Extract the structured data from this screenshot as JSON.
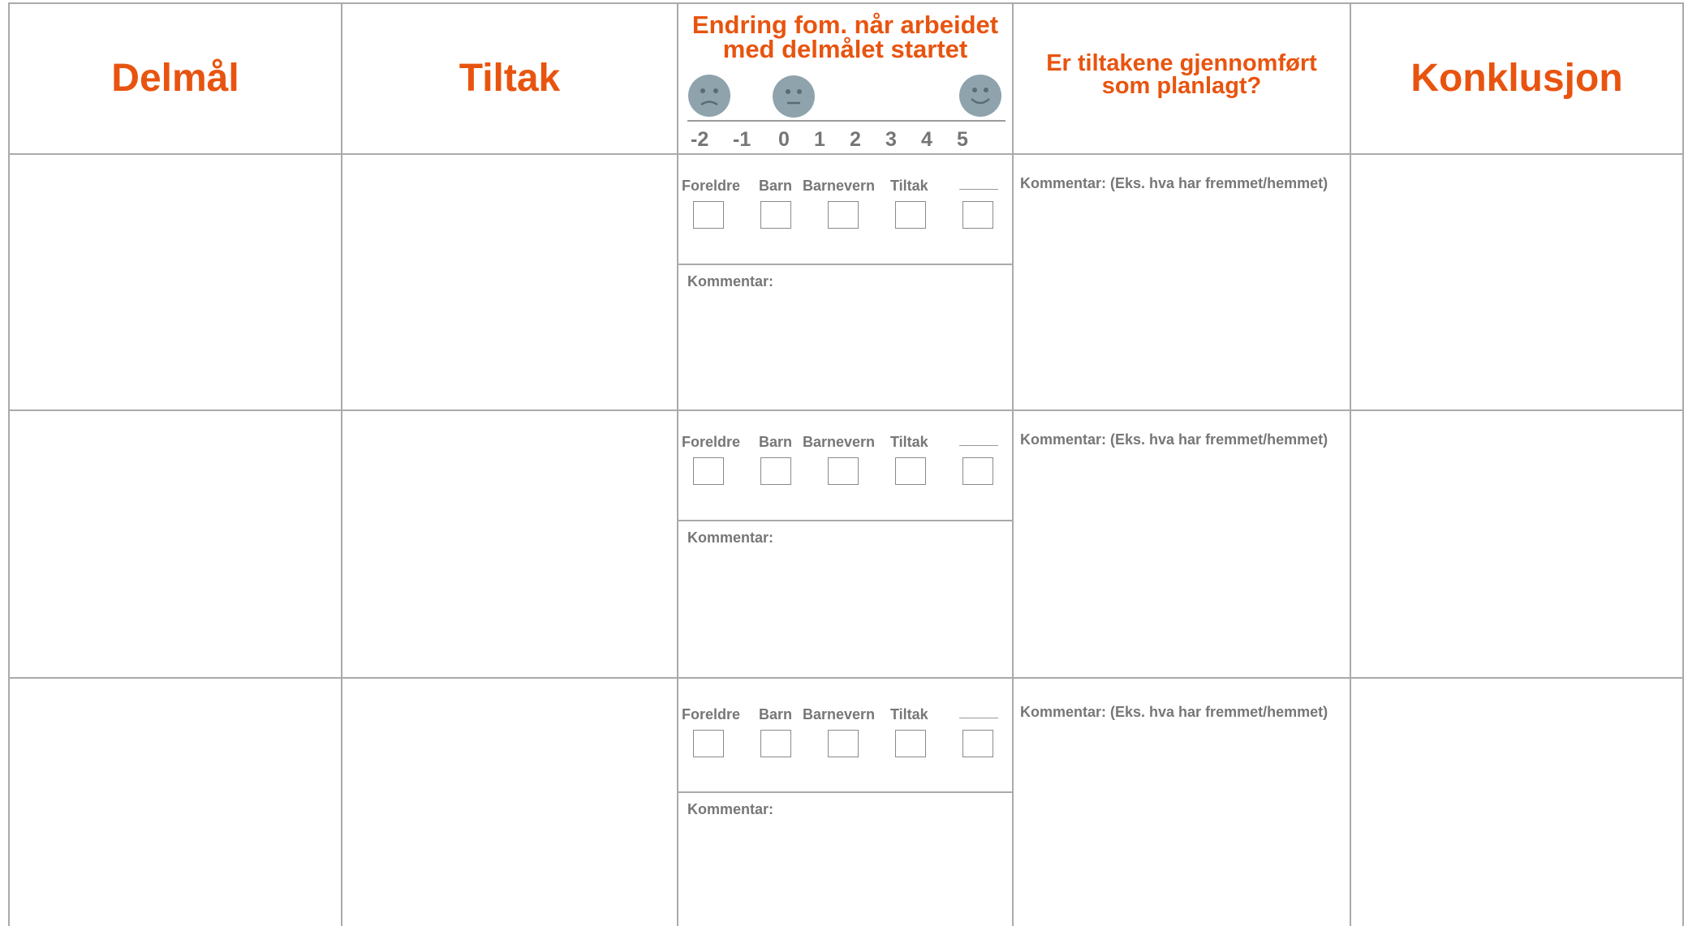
{
  "headers": {
    "delmal": "Delmål",
    "tiltak": "Tiltak",
    "endring_line1": "Endring fom. når arbeidet",
    "endring_line2": "med delmålet startet",
    "gjennomfort_line1": "Er tiltakene gjennomført",
    "gjennomfort_line2": "som planlagt?",
    "konklusjon": "Konklusjon"
  },
  "scale": [
    "-2",
    "-1",
    "0",
    "1",
    "2",
    "3",
    "4",
    "5"
  ],
  "faces": [
    "sad-face-icon",
    "neutral-face-icon",
    "happy-face-icon"
  ],
  "options": [
    "Foreldre",
    "Barn",
    "Barnevern",
    "Tiltak"
  ],
  "rows": [
    {
      "comment": "Kommentar:",
      "implementation_comment": "Kommentar: (Eks. hva har fremmet/hemmet)"
    },
    {
      "comment": "Kommentar:",
      "implementation_comment": "Kommentar: (Eks. hva har fremmet/hemmet)"
    },
    {
      "comment": "Kommentar:",
      "implementation_comment": "Kommentar: (Eks. hva har fremmet/hemmet)"
    }
  ],
  "colors": {
    "accent": "#e8540f",
    "grid": "#aaaaaa",
    "label": "#777777",
    "face": "#8fa3ad"
  }
}
